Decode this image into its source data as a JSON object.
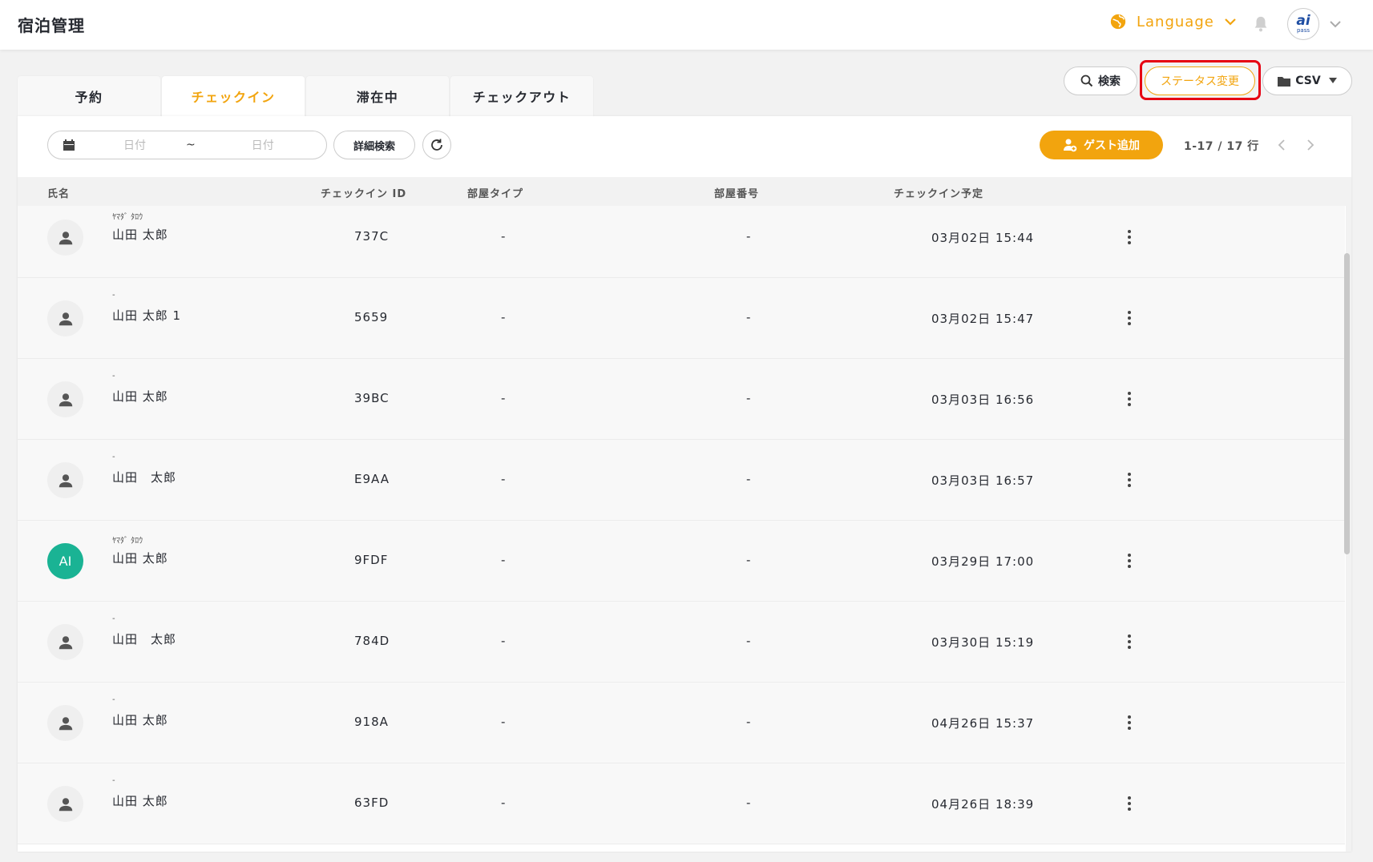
{
  "app": {
    "title": "宿泊管理"
  },
  "header": {
    "language_label": "Language"
  },
  "tabs": [
    {
      "label": "予約",
      "active": false
    },
    {
      "label": "チェックイン",
      "active": true
    },
    {
      "label": "滞在中",
      "active": false
    },
    {
      "label": "チェックアウト",
      "active": false
    }
  ],
  "actions": {
    "search_label": "検索",
    "status_change_label": "ステータス変更",
    "csv_label": "CSV"
  },
  "filters": {
    "date_from_placeholder": "日付",
    "date_separator": "~",
    "date_to_placeholder": "日付",
    "detail_search_label": "詳細検索",
    "add_guest_label": "ゲスト追加",
    "paging_text": "1-17 / 17 行"
  },
  "table": {
    "columns": {
      "name": "氏名",
      "checkin_id": "チェックイン ID",
      "room_type": "部屋タイプ",
      "room_number": "部屋番号",
      "checkin_date": "チェックイン予定"
    },
    "rows": [
      {
        "kana": "ﾔﾏﾀﾞ ﾀﾛｳ",
        "name": "山田 太郎",
        "checkin_id": "737C",
        "room_type": "-",
        "room_number": "-",
        "checkin_date": "03月02日 15:44",
        "avatar": "person",
        "avatar_text": ""
      },
      {
        "kana": "-",
        "name": "山田 太郎 1",
        "checkin_id": "5659",
        "room_type": "-",
        "room_number": "-",
        "checkin_date": "03月02日 15:47",
        "avatar": "person",
        "avatar_text": ""
      },
      {
        "kana": "-",
        "name": "山田 太郎",
        "checkin_id": "39BC",
        "room_type": "-",
        "room_number": "-",
        "checkin_date": "03月03日 16:56",
        "avatar": "person",
        "avatar_text": ""
      },
      {
        "kana": "-",
        "name": "山田　太郎",
        "checkin_id": "E9AA",
        "room_type": "-",
        "room_number": "-",
        "checkin_date": "03月03日 16:57",
        "avatar": "person",
        "avatar_text": ""
      },
      {
        "kana": "ﾔﾏﾀﾞ ﾀﾛｳ",
        "name": "山田 太郎",
        "checkin_id": "9FDF",
        "room_type": "-",
        "room_number": "-",
        "checkin_date": "03月29日 17:00",
        "avatar": "initials",
        "avatar_text": "AI"
      },
      {
        "kana": "-",
        "name": "山田　太郎",
        "checkin_id": "784D",
        "room_type": "-",
        "room_number": "-",
        "checkin_date": "03月30日 15:19",
        "avatar": "person",
        "avatar_text": ""
      },
      {
        "kana": "-",
        "name": "山田 太郎",
        "checkin_id": "918A",
        "room_type": "-",
        "room_number": "-",
        "checkin_date": "04月26日 15:37",
        "avatar": "person",
        "avatar_text": ""
      },
      {
        "kana": "-",
        "name": "山田 太郎",
        "checkin_id": "63FD",
        "room_type": "-",
        "room_number": "-",
        "checkin_date": "04月26日 18:39",
        "avatar": "person",
        "avatar_text": ""
      }
    ]
  },
  "colors": {
    "accent": "#f2a40e",
    "highlight_ring": "#e60012",
    "avatar_teal": "#1ab394"
  }
}
